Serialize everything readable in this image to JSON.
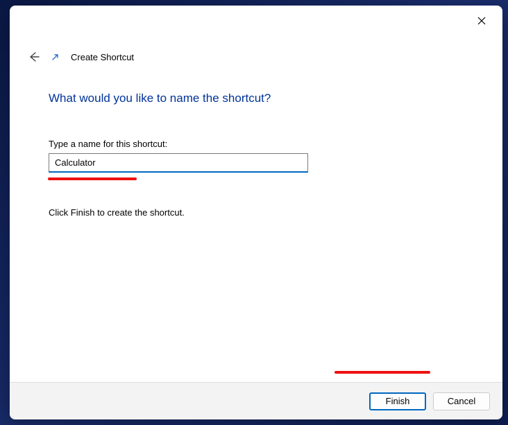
{
  "header": {
    "title": "Create Shortcut"
  },
  "main": {
    "heading": "What would you like to name the shortcut?",
    "field_label": "Type a name for this shortcut:",
    "field_value": "Calculator",
    "instruction": "Click Finish to create the shortcut."
  },
  "buttons": {
    "finish": "Finish",
    "cancel": "Cancel"
  }
}
